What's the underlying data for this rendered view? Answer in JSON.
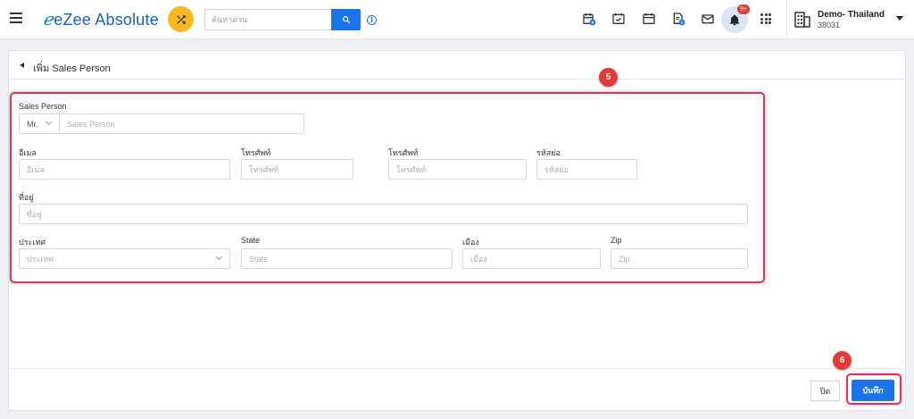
{
  "topbar": {
    "app_name": "eZee Absolute",
    "search_placeholder": "ค้นหาด่วน",
    "notification_badge": "9+",
    "property_name": "Demo- Thailand",
    "property_code": "38031",
    "icons": [
      "calendar-badge-icon",
      "calendar-check-icon",
      "calendar-icon",
      "document-badge-icon",
      "mail-icon",
      "bell-icon",
      "apps-grid-icon"
    ]
  },
  "page": {
    "title": "เพิ่ม Sales Person"
  },
  "form": {
    "sales_person_label": "Sales Person",
    "salutation_value": "Mr.",
    "sales_person_placeholder": "Sales Person",
    "email_label": "อีเมล",
    "email_placeholder": "อีเมล",
    "phone1_label": "โทรศัพท์",
    "phone1_placeholder": "โทรศัพท์",
    "phone2_label": "โทรศัพท์",
    "phone2_placeholder": "โทรศัพท์",
    "postal_label": "รหัสย่อ",
    "postal_placeholder": "รหัสย่อ",
    "address_label": "ที่อยู่",
    "address_placeholder": "ที่อยู่",
    "country_label": "ประเทศ",
    "country_placeholder": "ประเทศ",
    "state_label": "State",
    "state_placeholder": "State",
    "city_label": "เมือง",
    "city_placeholder": "เมือง",
    "zip_label": "Zip",
    "zip_placeholder": "Zip"
  },
  "footer": {
    "close_label": "ปิด",
    "save_label": "บันทึก"
  },
  "annotations": {
    "marker_form": "5",
    "marker_save": "6",
    "highlight_color": "#e8305a"
  },
  "colors": {
    "primary": "#1a73e8",
    "accent_yellow": "#f5b921",
    "badge_red": "#e53935"
  }
}
